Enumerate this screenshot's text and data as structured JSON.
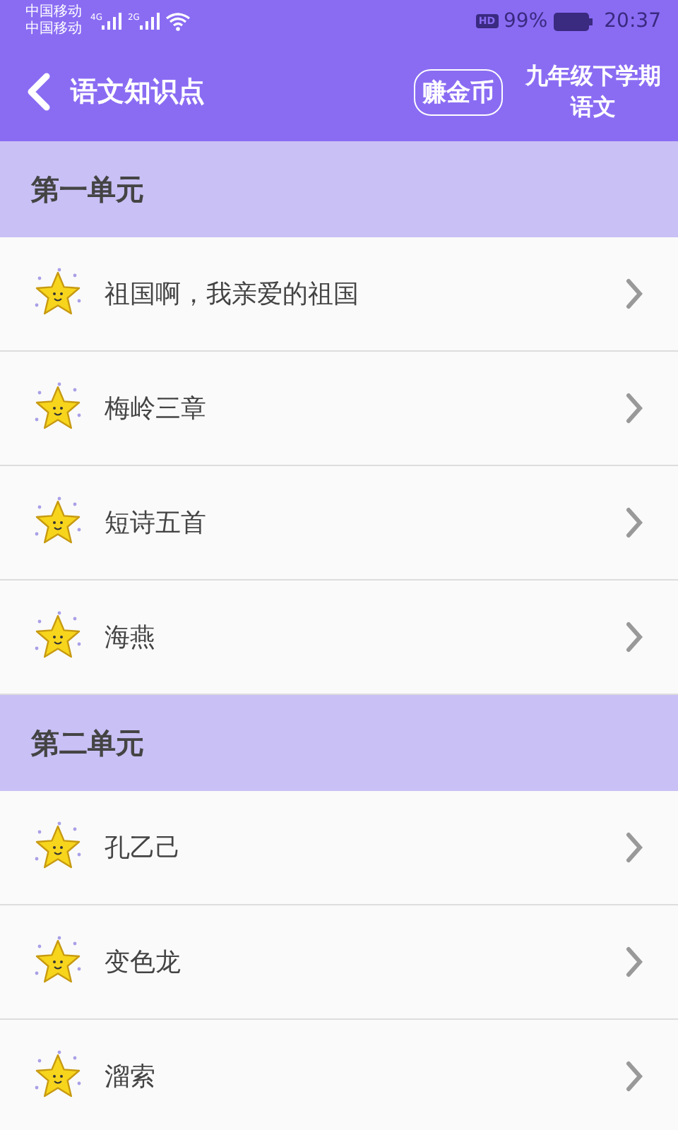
{
  "status_bar": {
    "carriers": [
      "中国移动",
      "中国移动"
    ],
    "signals": [
      "4G",
      "2G"
    ],
    "hd": "HD",
    "battery": "99%",
    "time": "20:37"
  },
  "header": {
    "title": "语文知识点",
    "coin_button": "赚金币",
    "grade": [
      "九年级下学期",
      "语文"
    ]
  },
  "sections": [
    {
      "title": "第一单元",
      "items": [
        "祖国啊，我亲爱的祖国",
        "梅岭三章",
        "短诗五首",
        "海燕"
      ]
    },
    {
      "title": "第二单元",
      "items": [
        "孔乙己",
        "变色龙",
        "溜索"
      ]
    }
  ]
}
